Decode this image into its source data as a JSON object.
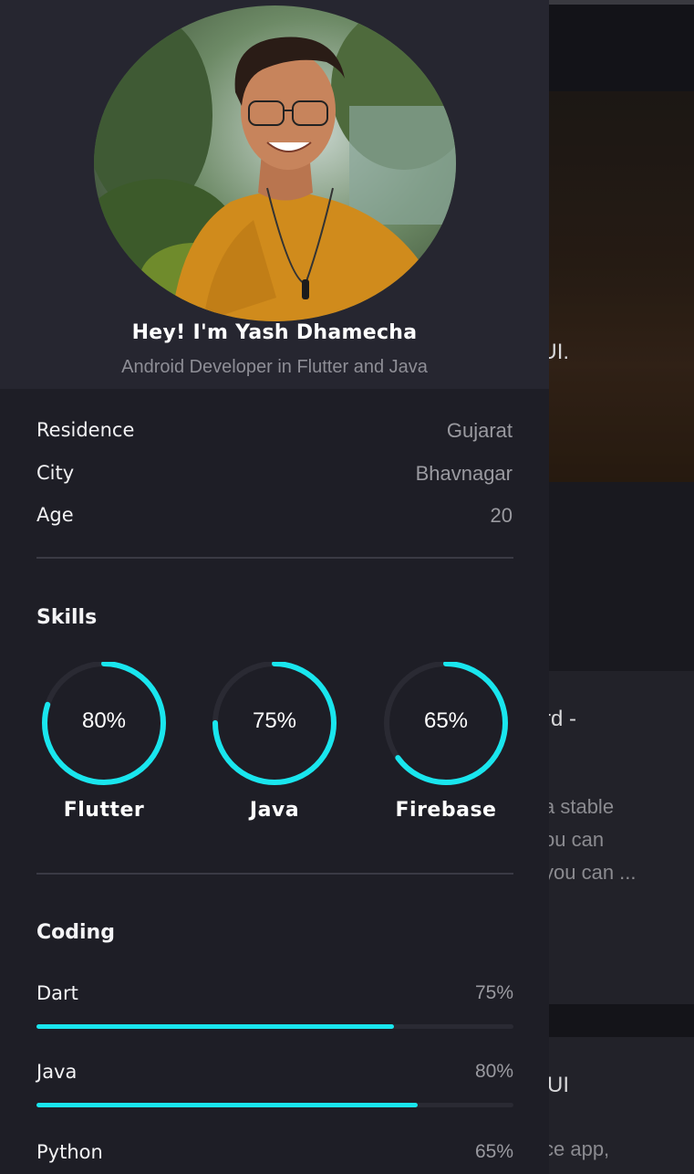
{
  "background_app": {
    "text_1": "pp UI.",
    "text_2": "rd -",
    "text_3_lines": [
      "a stable",
      "ou can",
      "you can ..."
    ],
    "text_4": "UI",
    "text_5": "ce app,"
  },
  "profile": {
    "name": "Hey! I'm Yash Dhamecha",
    "subtitle": "Android Developer in Flutter and Java"
  },
  "info": [
    {
      "label": "Residence",
      "value": "Gujarat"
    },
    {
      "label": "City",
      "value": "Bhavnagar"
    },
    {
      "label": "Age",
      "value": "20"
    }
  ],
  "skills": {
    "title": "Skills",
    "items": [
      {
        "name": "Flutter",
        "percent_label": "80%",
        "value": 0.8
      },
      {
        "name": "Java",
        "percent_label": "75%",
        "value": 0.75
      },
      {
        "name": "Firebase",
        "percent_label": "65%",
        "value": 0.65
      }
    ]
  },
  "coding": {
    "title": "Coding",
    "items": [
      {
        "name": "Dart",
        "percent_label": "75%",
        "value": 0.75
      },
      {
        "name": "Java",
        "percent_label": "80%",
        "value": 0.8
      },
      {
        "name": "Python",
        "percent_label": "65%",
        "value": 0.65
      }
    ]
  },
  "colors": {
    "accent": "#19e6ee",
    "drawer_bg": "#1e1e26",
    "header_bg": "#262630",
    "ring_track": "#2a2a33"
  }
}
